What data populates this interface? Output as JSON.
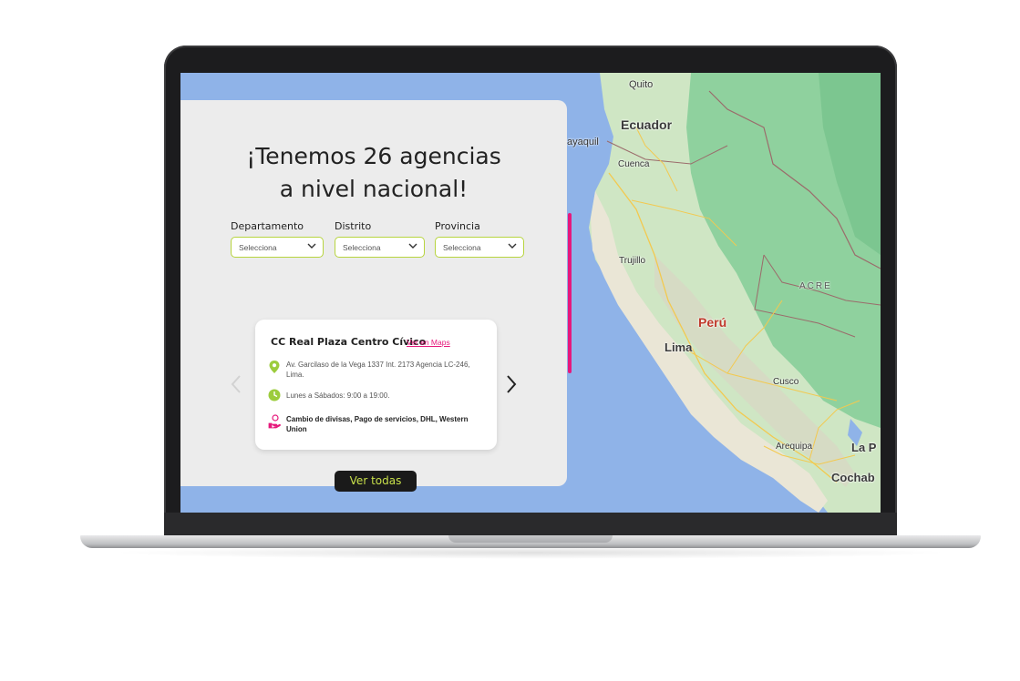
{
  "panel": {
    "title_line1": "¡Tenemos 26 agencias",
    "title_line2": "a nivel nacional!"
  },
  "filters": [
    {
      "label": "Departamento",
      "value": "Selecciona"
    },
    {
      "label": "Distrito",
      "value": "Selecciona"
    },
    {
      "label": "Provincia",
      "value": "Selecciona"
    }
  ],
  "agency": {
    "name": "CC Real Plaza Centro Cívico",
    "maps_link": "Ver en Maps",
    "address": "Av. Garcilaso de la Vega 1337 Int. 2173 Agencia LC-246, Lima.",
    "hours": "Lunes a Sábados: 9:00 a 19:00.",
    "services": "Cambio de divisas, Pago de servicios, DHL, Western Union"
  },
  "cta": {
    "label": "Ver todas"
  },
  "map_labels": {
    "quito": "Quito",
    "ecuador": "Ecuador",
    "guayaquil": "ayaquil",
    "cuenca": "Cuenca",
    "trujillo": "Trujillo",
    "acre": "ACRE",
    "peru": "Perú",
    "lima": "Lima",
    "cusco": "Cusco",
    "arequipa": "Arequipa",
    "lapaz": "La P",
    "cochabamba": "Cochab"
  },
  "colors": {
    "accent_pink": "#e6197c",
    "accent_lime": "#b7d43f",
    "ocean": "#8fb3e8",
    "land": "#cfe6c4",
    "forest": "#8fd19e"
  },
  "icons": [
    "map-pin-icon",
    "clock-icon",
    "hand-coin-icon",
    "chevron-down-icon",
    "chevron-left-icon",
    "chevron-right-icon"
  ]
}
